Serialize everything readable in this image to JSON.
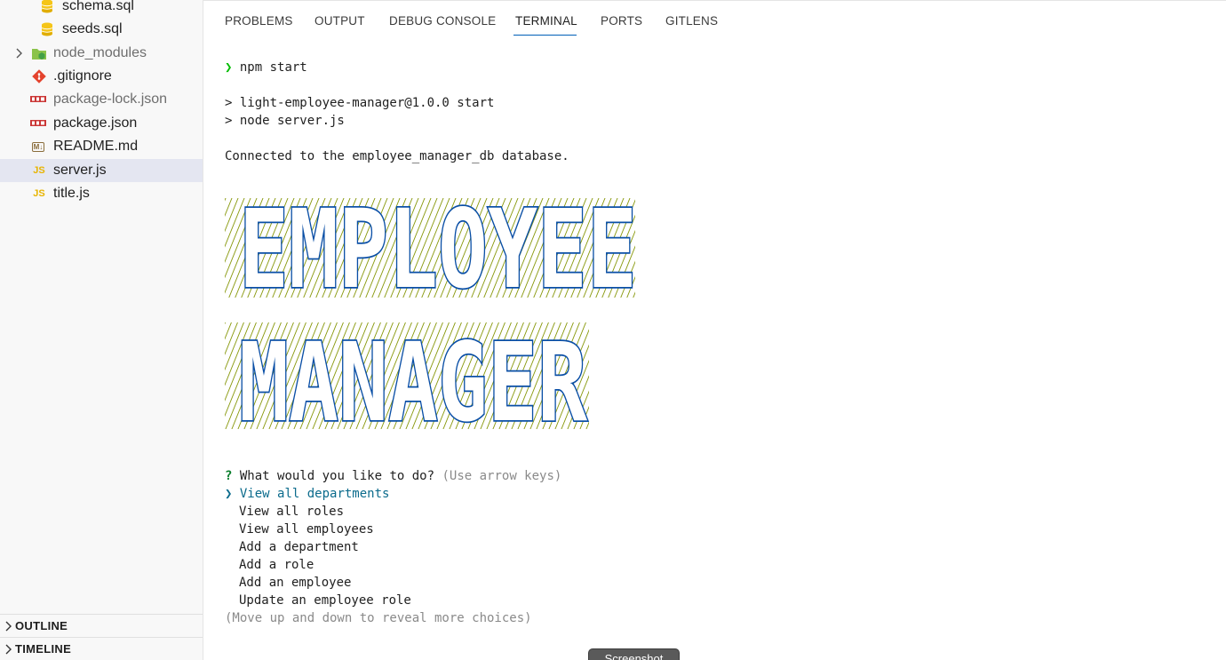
{
  "explorer": {
    "items": [
      {
        "label": "schema.sql",
        "icon": "database-icon"
      },
      {
        "label": "seeds.sql",
        "icon": "database-icon"
      },
      {
        "label": "node_modules",
        "icon": "node-folder-icon"
      },
      {
        "label": ".gitignore",
        "icon": "git-icon"
      },
      {
        "label": "package-lock.json",
        "icon": "npm-icon"
      },
      {
        "label": "package.json",
        "icon": "npm-icon"
      },
      {
        "label": "README.md",
        "icon": "markdown-icon"
      },
      {
        "label": "server.js",
        "icon": "js-icon"
      },
      {
        "label": "title.js",
        "icon": "js-icon"
      }
    ],
    "js_badge": "JS",
    "md_badge": "M↓",
    "sections": [
      {
        "label": "OUTLINE"
      },
      {
        "label": "TIMELINE"
      }
    ]
  },
  "panel": {
    "tabs": [
      {
        "label": "PROBLEMS"
      },
      {
        "label": "OUTPUT"
      },
      {
        "label": "DEBUG CONSOLE"
      },
      {
        "label": "TERMINAL"
      },
      {
        "label": "PORTS"
      },
      {
        "label": "GITLENS"
      }
    ],
    "active_tab": "TERMINAL"
  },
  "terminal": {
    "prompt_symbol": "❯",
    "command": "npm start",
    "script_line": "> light-employee-manager@1.0.0 start",
    "node_line": "> node server.js",
    "connected": "Connected to the employee_manager_db database.",
    "banner_lines": [
      "EMPLOYEE",
      "MANAGER"
    ],
    "question_mark": "?",
    "question": "What would you like to do?",
    "question_hint": "(Use arrow keys)",
    "pointer": "❯",
    "choices": [
      "View all departments",
      "View all roles",
      "View all employees",
      "Add a department",
      "Add a role",
      "Add an employee",
      "Update an employee role"
    ],
    "footer_hint": "(Move up and down to reveal more choices)"
  },
  "screenshot_button": "Screenshot",
  "colors": {
    "banner_letter": "#0a4fa6",
    "banner_stripes": "#8a9a10",
    "prompt_green": "#00bc00",
    "selected_choice": "#0b6b8c",
    "tab_underline": "#005fb8",
    "js_yellow": "#e8b400",
    "npm_red": "#cb3837",
    "git_red": "#e4432d"
  }
}
